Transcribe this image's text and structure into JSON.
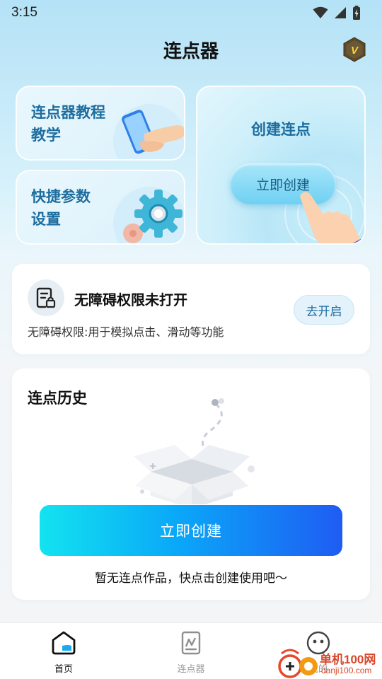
{
  "status_bar": {
    "time": "3:15"
  },
  "header": {
    "title": "连点器",
    "vip_badge_letter": "V"
  },
  "cards": {
    "tutorial": {
      "line1": "连点器教程",
      "line2": "教学"
    },
    "params": {
      "line1": "快捷参数",
      "line2": "设置"
    },
    "create": {
      "title": "创建连点",
      "button": "立即创建"
    }
  },
  "accessibility": {
    "title": "无障碍权限未打开",
    "description": "无障碍权限:用于模拟点击、滑动等功能",
    "button": "去开启"
  },
  "history": {
    "title": "连点历史",
    "create_button": "立即创建",
    "empty_text": "暂无连点作品，快点击创建使用吧～"
  },
  "bottom_nav": {
    "items": [
      {
        "label": "首页",
        "active": true
      },
      {
        "label": "连点器",
        "active": false
      },
      {
        "label": "我的",
        "active": false
      }
    ]
  },
  "watermark": {
    "title": "单机100网",
    "url": "danji100.com"
  },
  "colors": {
    "accent_text": "#1d6d9f",
    "create_gradient_start": "#13e3f0",
    "create_gradient_end": "#1f5cf3"
  }
}
